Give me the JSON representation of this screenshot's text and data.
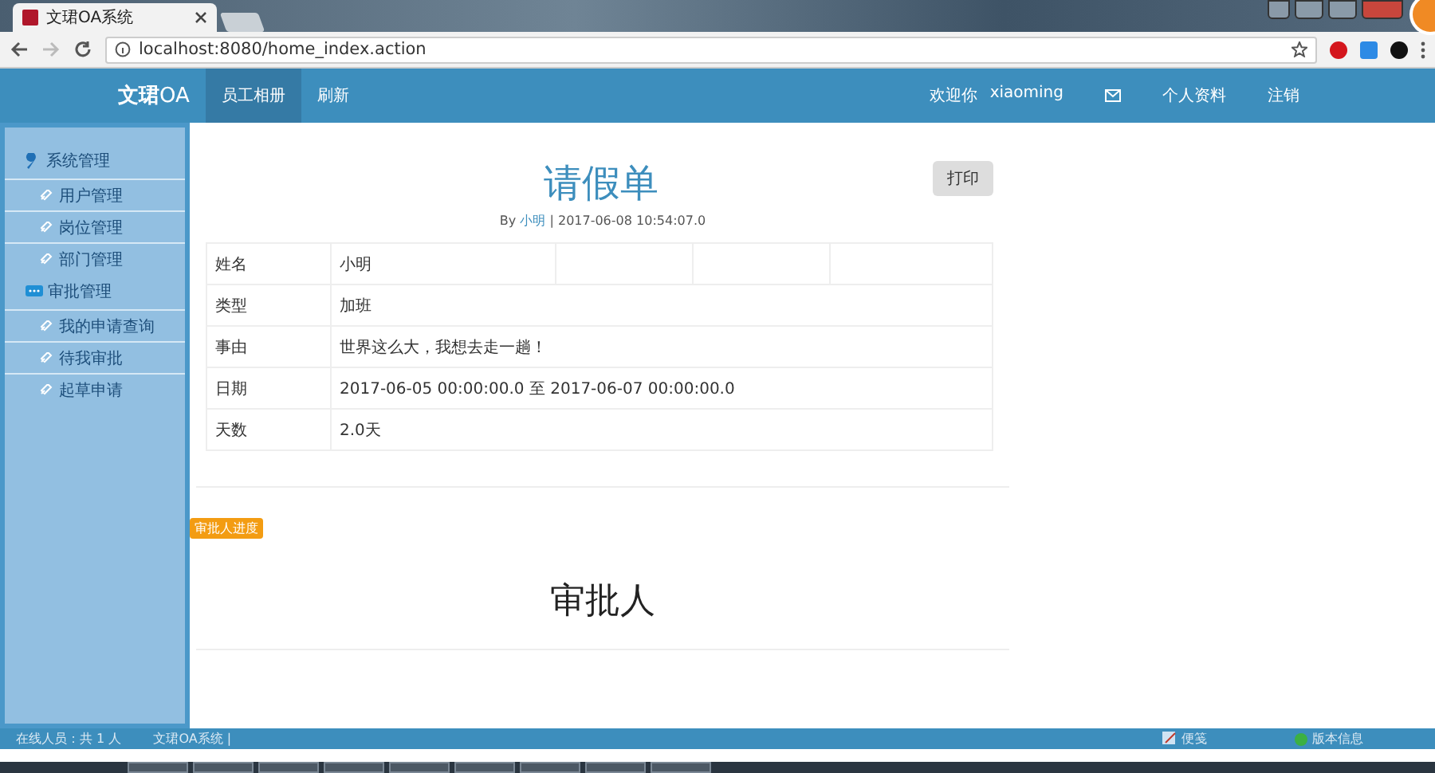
{
  "browser": {
    "tab_title": "文珺OA系统",
    "url": "localhost:8080/home_index.action"
  },
  "navbar": {
    "brand": "**文珺**OA",
    "items": [
      {
        "label": "员工相册",
        "selected": true
      },
      {
        "label": "刷新",
        "selected": false
      }
    ],
    "welcome": "欢迎你",
    "user": "xiaoming",
    "links": [
      "个人资料",
      "注销"
    ]
  },
  "sidebar": {
    "groups": [
      {
        "label": "系统管理",
        "children": [
          {
            "label": "用户管理"
          },
          {
            "label": "岗位管理"
          },
          {
            "label": "部门管理"
          }
        ]
      },
      {
        "label": "审批管理",
        "children": [
          {
            "label": "我的申请查询"
          },
          {
            "label": "待我审批"
          },
          {
            "label": "起草申请"
          }
        ]
      }
    ]
  },
  "form": {
    "title": "请假单",
    "by": "By",
    "author": "小明",
    "time": "| 2017-06-08 10:54:07.0",
    "print_button": "打印",
    "rows": [
      {
        "label": "姓名",
        "value": "小明"
      },
      {
        "label": "类型",
        "value": "加班"
      },
      {
        "label": "事由",
        "value": "世界这么大，我想去走一趟！"
      },
      {
        "label": "日期",
        "value": "2017-06-05 00:00:00.0 至 2017-06-07 00:00:00.0"
      },
      {
        "label": "天数",
        "value": "2.0天"
      }
    ]
  },
  "progress_badge": "审批人进度",
  "approver_heading": "审批人",
  "footer": {
    "online": "在线人员：共 1 人",
    "system": "文珺OA系统 |",
    "notes": "便笺",
    "version": "版本信息"
  }
}
